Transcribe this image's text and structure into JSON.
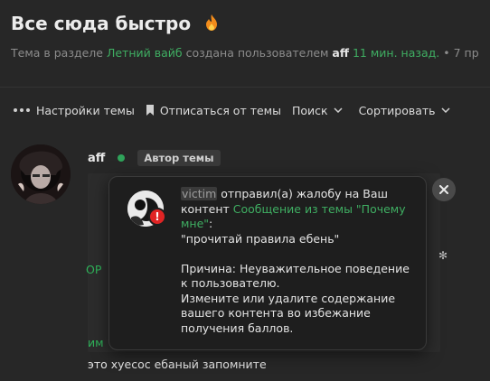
{
  "header": {
    "title": "Все сюда быстро",
    "title_emoji": "fire-icon",
    "meta_prefix": "Тема в разделе",
    "section": "Летний вайб",
    "meta_created": "создана пользователем",
    "author": "aff",
    "time_ago": "11 мин. назад.",
    "meta_tail": "• 7 пр"
  },
  "toolbar": {
    "settings": "Настройки темы",
    "unsubscribe": "Отписаться от темы",
    "search": "Поиск",
    "sort": "Сортировать"
  },
  "post": {
    "author": "aff",
    "badge": "Автор темы",
    "fragment_op": "ОР",
    "fragment_im": "им",
    "body": "это хуесос ебаный запомните"
  },
  "toast": {
    "reporter": "victim",
    "action": " отправил(а) жалобу на Ваш контент ",
    "link": "Сообщение из темы \"Почему мне\"",
    "colon": ":",
    "quote": "\"прочитай правила ебень\"",
    "reason": "Причина: Неуважительное поведение к пользователю.",
    "instruction": "Измените или удалите содержание вашего контента во избежание получения баллов.",
    "warn_glyph": "!"
  },
  "colors": {
    "accent_green": "#3fae62",
    "online_dot": "#2fa35a",
    "warn_red": "#e02424",
    "background": "#272727"
  }
}
